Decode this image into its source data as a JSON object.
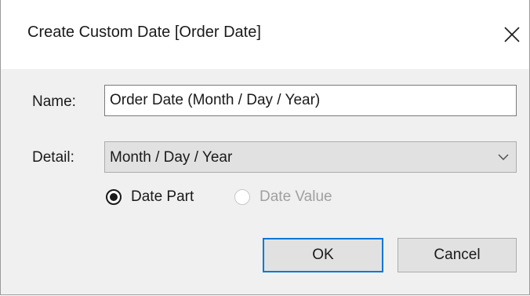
{
  "dialog": {
    "title": "Create Custom Date [Order Date]",
    "close_icon": "close-icon"
  },
  "form": {
    "name_label": "Name:",
    "name_value": "Order Date (Month / Day / Year)",
    "detail_label": "Detail:",
    "detail_value": "Month / Day / Year",
    "detail_icon": "chevron-down-icon"
  },
  "radios": {
    "date_part": {
      "label": "Date Part",
      "selected": true
    },
    "date_value": {
      "label": "Date Value",
      "selected": false,
      "disabled": true
    }
  },
  "buttons": {
    "ok_label": "OK",
    "cancel_label": "Cancel"
  },
  "colors": {
    "accent": "#0078d7",
    "dialog_background": "#f0f0f0",
    "button_background": "#e1e1e1",
    "disabled_text": "#a0a0a0"
  }
}
